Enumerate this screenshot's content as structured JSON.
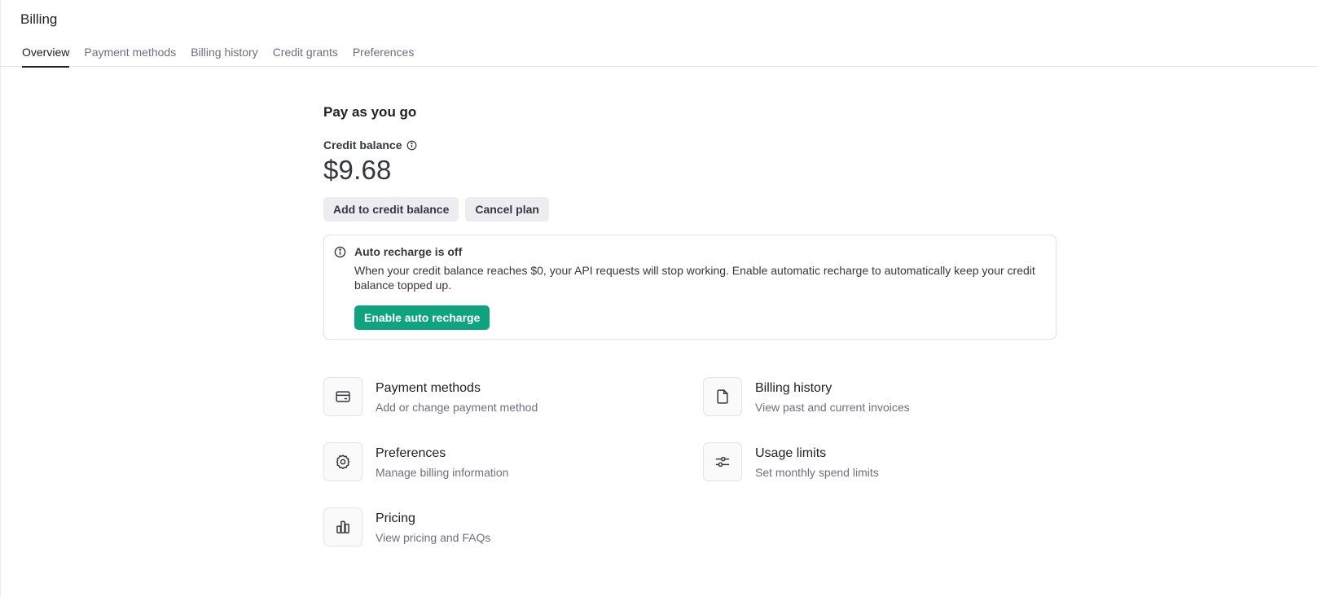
{
  "header": {
    "title": "Billing",
    "tabs": [
      {
        "label": "Overview",
        "active": true
      },
      {
        "label": "Payment methods",
        "active": false
      },
      {
        "label": "Billing history",
        "active": false
      },
      {
        "label": "Credit grants",
        "active": false
      },
      {
        "label": "Preferences",
        "active": false
      }
    ]
  },
  "plan": {
    "title": "Pay as you go",
    "credit_label": "Credit balance",
    "credit_amount": "$9.68",
    "add_credit_label": "Add to credit balance",
    "cancel_plan_label": "Cancel plan"
  },
  "notice": {
    "title": "Auto recharge is off",
    "body": "When your credit balance reaches $0, your API requests will stop working. Enable automatic recharge to automatically keep your credit balance topped up.",
    "button_label": "Enable auto recharge"
  },
  "links": [
    {
      "icon": "credit-card-icon",
      "title": "Payment methods",
      "desc": "Add or change payment method"
    },
    {
      "icon": "document-icon",
      "title": "Billing history",
      "desc": "View past and current invoices"
    },
    {
      "icon": "gear-icon",
      "title": "Preferences",
      "desc": "Manage billing information"
    },
    {
      "icon": "sliders-icon",
      "title": "Usage limits",
      "desc": "Set monthly spend limits"
    },
    {
      "icon": "bar-chart-icon",
      "title": "Pricing",
      "desc": "View pricing and FAQs"
    }
  ],
  "colors": {
    "accent": "#10a37f",
    "text": "#202123",
    "muted": "#6e6e80",
    "secondary_button": "#ececf1"
  }
}
